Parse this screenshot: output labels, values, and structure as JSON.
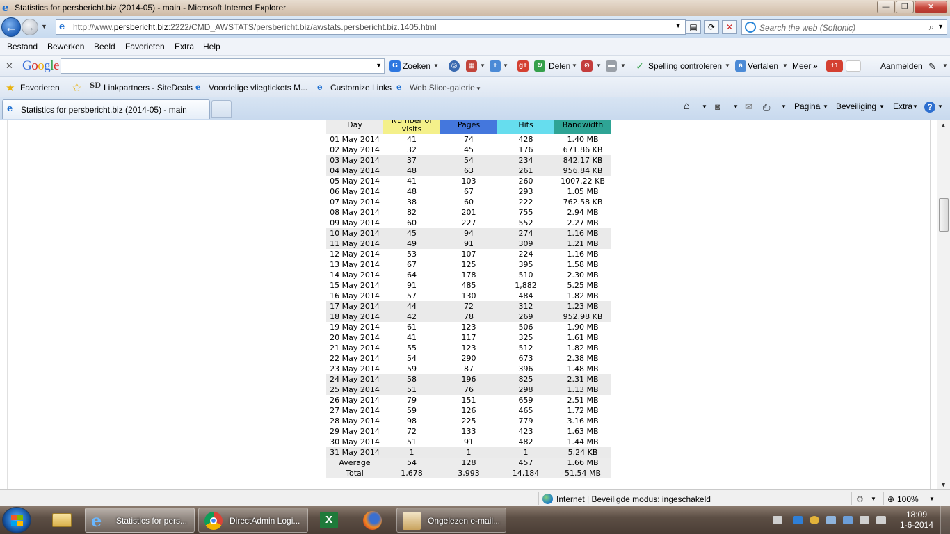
{
  "window": {
    "title": "Statistics for persbericht.biz (2014-05) - main - Microsoft Internet Explorer",
    "min": "—",
    "max": "❐",
    "close": "✕"
  },
  "address": {
    "url_pre": "http://www.",
    "url_domain": "persbericht.biz",
    "url_post": ":2222/CMD_AWSTATS/persbericht.biz/awstats.persbericht.biz.1405.html",
    "search_placeholder": "Search the web (Softonic)"
  },
  "menu": [
    "Bestand",
    "Bewerken",
    "Beeld",
    "Favorieten",
    "Extra",
    "Help"
  ],
  "google_toolbar": {
    "logo": [
      "G",
      "o",
      "o",
      "g",
      "l",
      "e"
    ],
    "logo_colors": [
      "#3b6fd8",
      "#d7312d",
      "#f0b110",
      "#3b6fd8",
      "#2e9e43",
      "#d7312d"
    ],
    "zoeken": "Zoeken",
    "delen": "Delen",
    "spelling": "Spelling controleren",
    "vertalen": "Vertalen",
    "meer": "Meer",
    "gplus": "+1",
    "aanmelden": "Aanmelden"
  },
  "favorites": {
    "favorieten": "Favorieten",
    "links": [
      "Linkpartners - SiteDeals",
      "Voordelige vliegtickets M...",
      "Customize Links",
      "Web Slice-galerie"
    ]
  },
  "tab": {
    "label": "Statistics for persbericht.biz (2014-05) - main"
  },
  "command_bar": [
    "Pagina",
    "Beveiliging",
    "Extra"
  ],
  "stats": {
    "headers": {
      "day": "Day",
      "visits": "Number of visits",
      "pages": "Pages",
      "hits": "Hits",
      "bandwidth": "Bandwidth"
    },
    "rows": [
      {
        "day": "01 May 2014",
        "visits": "41",
        "pages": "74",
        "hits": "428",
        "bw": "1.40 MB",
        "weekend": false
      },
      {
        "day": "02 May 2014",
        "visits": "32",
        "pages": "45",
        "hits": "176",
        "bw": "671.86 KB",
        "weekend": false
      },
      {
        "day": "03 May 2014",
        "visits": "37",
        "pages": "54",
        "hits": "234",
        "bw": "842.17 KB",
        "weekend": true
      },
      {
        "day": "04 May 2014",
        "visits": "48",
        "pages": "63",
        "hits": "261",
        "bw": "956.84 KB",
        "weekend": true
      },
      {
        "day": "05 May 2014",
        "visits": "41",
        "pages": "103",
        "hits": "260",
        "bw": "1007.22 KB",
        "weekend": false
      },
      {
        "day": "06 May 2014",
        "visits": "48",
        "pages": "67",
        "hits": "293",
        "bw": "1.05 MB",
        "weekend": false
      },
      {
        "day": "07 May 2014",
        "visits": "38",
        "pages": "60",
        "hits": "222",
        "bw": "762.58 KB",
        "weekend": false
      },
      {
        "day": "08 May 2014",
        "visits": "82",
        "pages": "201",
        "hits": "755",
        "bw": "2.94 MB",
        "weekend": false
      },
      {
        "day": "09 May 2014",
        "visits": "60",
        "pages": "227",
        "hits": "552",
        "bw": "2.27 MB",
        "weekend": false
      },
      {
        "day": "10 May 2014",
        "visits": "45",
        "pages": "94",
        "hits": "274",
        "bw": "1.16 MB",
        "weekend": true
      },
      {
        "day": "11 May 2014",
        "visits": "49",
        "pages": "91",
        "hits": "309",
        "bw": "1.21 MB",
        "weekend": true
      },
      {
        "day": "12 May 2014",
        "visits": "53",
        "pages": "107",
        "hits": "224",
        "bw": "1.16 MB",
        "weekend": false
      },
      {
        "day": "13 May 2014",
        "visits": "67",
        "pages": "125",
        "hits": "395",
        "bw": "1.58 MB",
        "weekend": false
      },
      {
        "day": "14 May 2014",
        "visits": "64",
        "pages": "178",
        "hits": "510",
        "bw": "2.30 MB",
        "weekend": false
      },
      {
        "day": "15 May 2014",
        "visits": "91",
        "pages": "485",
        "hits": "1,882",
        "bw": "5.25 MB",
        "weekend": false
      },
      {
        "day": "16 May 2014",
        "visits": "57",
        "pages": "130",
        "hits": "484",
        "bw": "1.82 MB",
        "weekend": false
      },
      {
        "day": "17 May 2014",
        "visits": "44",
        "pages": "72",
        "hits": "312",
        "bw": "1.23 MB",
        "weekend": true
      },
      {
        "day": "18 May 2014",
        "visits": "42",
        "pages": "78",
        "hits": "269",
        "bw": "952.98 KB",
        "weekend": true
      },
      {
        "day": "19 May 2014",
        "visits": "61",
        "pages": "123",
        "hits": "506",
        "bw": "1.90 MB",
        "weekend": false
      },
      {
        "day": "20 May 2014",
        "visits": "41",
        "pages": "117",
        "hits": "325",
        "bw": "1.61 MB",
        "weekend": false
      },
      {
        "day": "21 May 2014",
        "visits": "55",
        "pages": "123",
        "hits": "512",
        "bw": "1.82 MB",
        "weekend": false
      },
      {
        "day": "22 May 2014",
        "visits": "54",
        "pages": "290",
        "hits": "673",
        "bw": "2.38 MB",
        "weekend": false
      },
      {
        "day": "23 May 2014",
        "visits": "59",
        "pages": "87",
        "hits": "396",
        "bw": "1.48 MB",
        "weekend": false
      },
      {
        "day": "24 May 2014",
        "visits": "58",
        "pages": "196",
        "hits": "825",
        "bw": "2.31 MB",
        "weekend": true
      },
      {
        "day": "25 May 2014",
        "visits": "51",
        "pages": "76",
        "hits": "298",
        "bw": "1.13 MB",
        "weekend": true
      },
      {
        "day": "26 May 2014",
        "visits": "79",
        "pages": "151",
        "hits": "659",
        "bw": "2.51 MB",
        "weekend": false
      },
      {
        "day": "27 May 2014",
        "visits": "59",
        "pages": "126",
        "hits": "465",
        "bw": "1.72 MB",
        "weekend": false
      },
      {
        "day": "28 May 2014",
        "visits": "98",
        "pages": "225",
        "hits": "779",
        "bw": "3.16 MB",
        "weekend": false
      },
      {
        "day": "29 May 2014",
        "visits": "72",
        "pages": "133",
        "hits": "423",
        "bw": "1.63 MB",
        "weekend": false
      },
      {
        "day": "30 May 2014",
        "visits": "51",
        "pages": "91",
        "hits": "482",
        "bw": "1.44 MB",
        "weekend": false
      },
      {
        "day": "31 May 2014",
        "visits": "1",
        "pages": "1",
        "hits": "1",
        "bw": "5.24 KB",
        "weekend": true
      }
    ],
    "average": {
      "label": "Average",
      "visits": "54",
      "pages": "128",
      "hits": "457",
      "bw": "1.66 MB"
    },
    "total": {
      "label": "Total",
      "visits": "1,678",
      "pages": "3,993",
      "hits": "14,184",
      "bw": "51.54 MB"
    }
  },
  "statusbar": {
    "text": "Internet | Beveiligde modus: ingeschakeld",
    "zoom": "100%"
  },
  "taskbar": {
    "tasks": [
      "Statistics for pers...",
      "DirectAdmin Logi...",
      "Ongelezen e-mail..."
    ],
    "time": "18:09",
    "date": "1-6-2014"
  },
  "colors": {
    "visits": "#f4f08a",
    "pages": "#4477dd",
    "hits": "#66ddee",
    "bandwidth": "#2ea495"
  }
}
